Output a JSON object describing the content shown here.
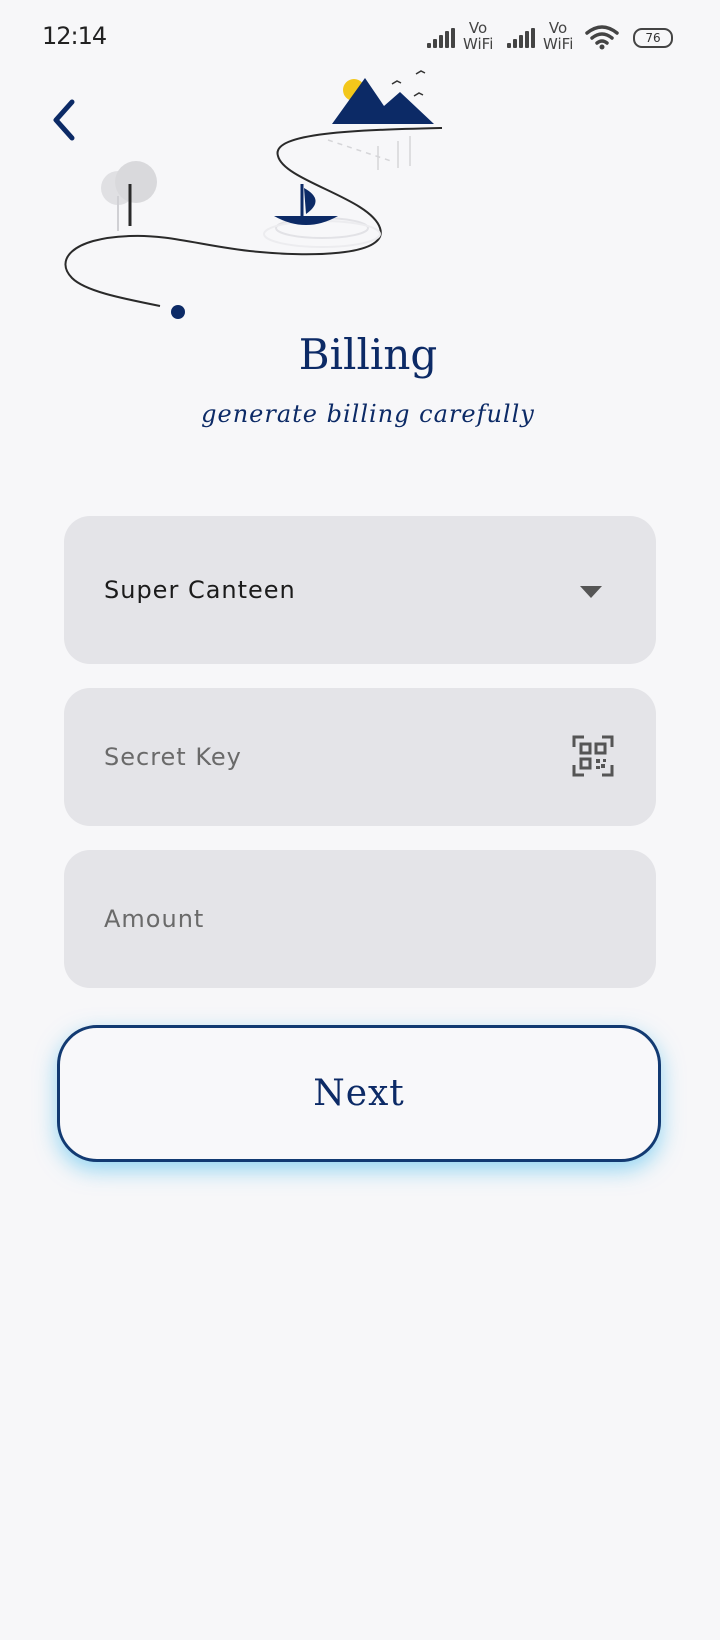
{
  "status_bar": {
    "time": "12:14",
    "network_1": "Vo WiFi",
    "network_2": "Vo WiFi",
    "battery": "76"
  },
  "header": {
    "back_icon": "chevron-left-icon",
    "illustration": "landscape-path-boat-illustration"
  },
  "page": {
    "title": "Billing",
    "subtitle": "generate billing carefully"
  },
  "form": {
    "canteen_select": {
      "selected": "Super Canteen",
      "icon": "caret-down-icon"
    },
    "secret_key": {
      "placeholder": "Secret Key",
      "value": "",
      "icon": "qr-scan-icon"
    },
    "amount": {
      "placeholder": "Amount",
      "value": ""
    },
    "next_label": "Next"
  },
  "colors": {
    "primary": "#0c2a66",
    "field_bg": "#e4e4e8",
    "background": "#f7f7f9",
    "button_glow": "#42baec"
  }
}
